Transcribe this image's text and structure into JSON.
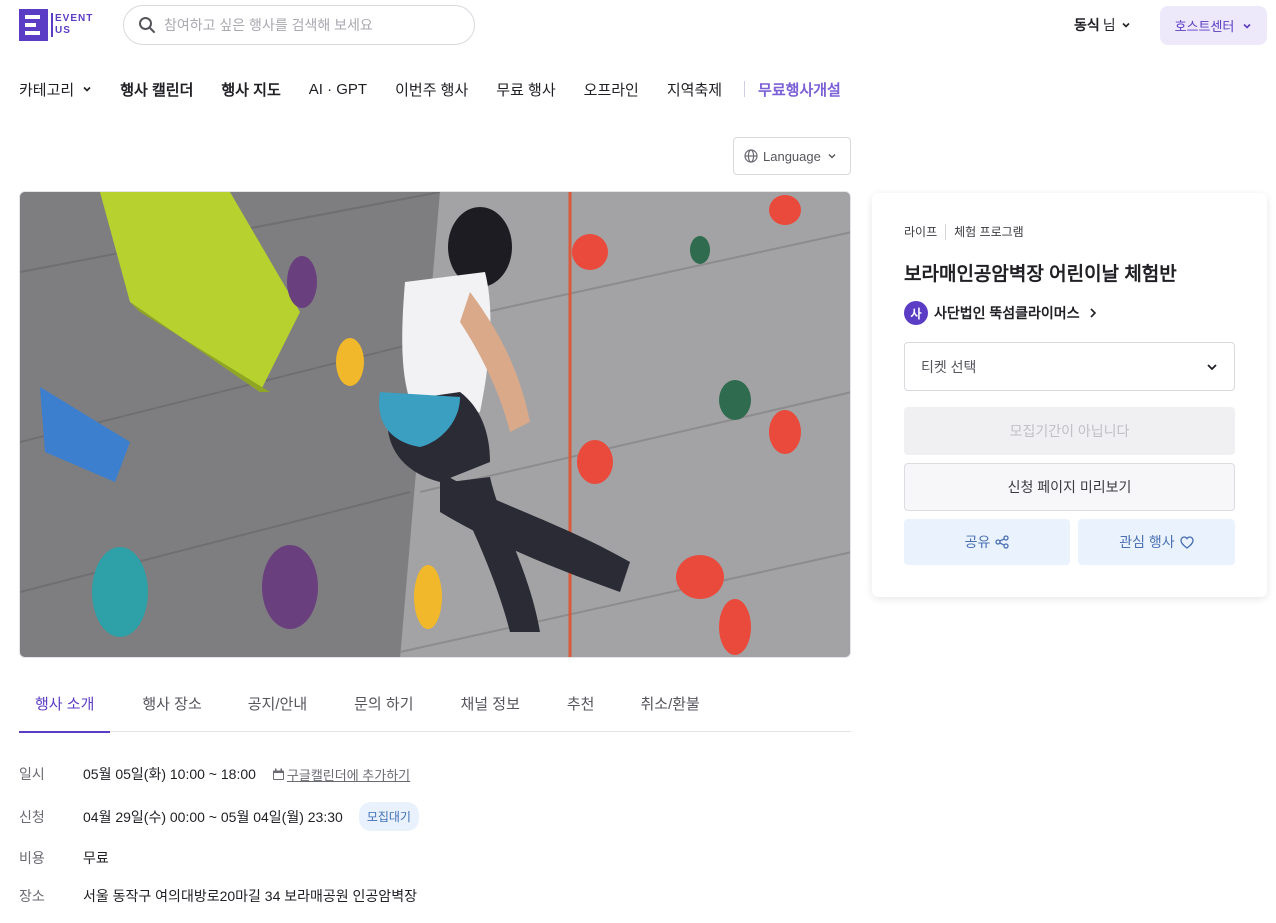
{
  "header": {
    "logo_text_top": "EVENT",
    "logo_text_bottom": "US",
    "search_placeholder": "참여하고 싶은 행사를 검색해 보세요",
    "user_name": "동식",
    "user_suffix": "님",
    "host_center": "호스트센터"
  },
  "nav": {
    "category": "카테고리",
    "calendar": "행사 캘린더",
    "map": "행사 지도",
    "ai": "AI · GPT",
    "this_week": "이번주 행사",
    "free": "무료 행사",
    "offline": "오프라인",
    "festival": "지역축제",
    "open_free": "무료행사개설"
  },
  "language": "Language",
  "card": {
    "crumb_1": "라이프",
    "crumb_2": "체험 프로그램",
    "title": "보라매인공암벽장 어린이날 체험반",
    "host_avatar": "사",
    "host_name": "사단법인 뚝섬클라이머스",
    "ticket_select": "티켓 선택",
    "not_recruiting": "모집기간이 아닙니다",
    "preview": "신청 페이지 미리보기",
    "share": "공유",
    "like": "관심 행사"
  },
  "tabs": [
    "행사 소개",
    "행사 장소",
    "공지/안내",
    "문의 하기",
    "채널 정보",
    "추천",
    "취소/환불"
  ],
  "info": {
    "date_label": "일시",
    "date_value": "05월 05일(화) 10:00 ~ 18:00",
    "gcal": "구글캘린더에 추가하기",
    "apply_label": "신청",
    "apply_value": "04월 29일(수) 00:00 ~ 05월 04일(월) 23:30",
    "apply_badge": "모집대기",
    "cost_label": "비용",
    "cost_value": "무료",
    "place_label": "장소",
    "place_value": "서울 동작구 여의대방로20마길 34 보라매공원 인공암벽장"
  },
  "colors": {
    "brand": "#5b3cc4",
    "accent_link": "#7b5fd6",
    "soft_blue": "#eaf3fd"
  }
}
